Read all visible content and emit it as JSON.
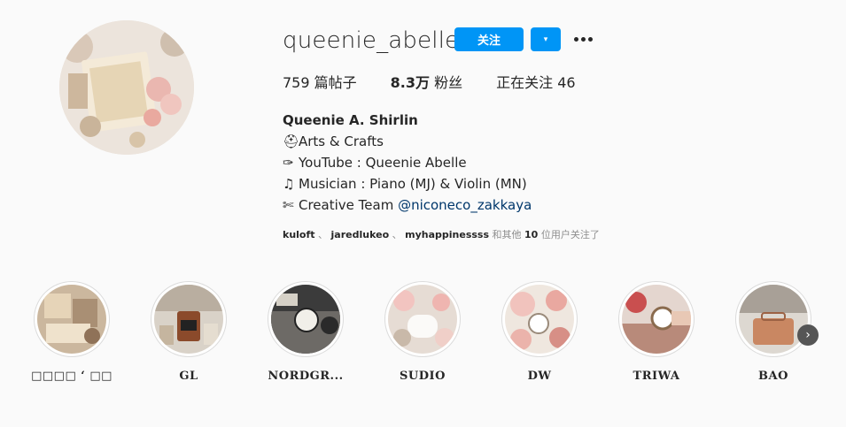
{
  "profile": {
    "username": "queenie_abelle",
    "follow_label": "关注",
    "dropdown_icon": "▾",
    "more_icon": "more-options-icon"
  },
  "stats": {
    "posts_value": "759",
    "posts_label": "篇帖子",
    "followers_value": "8.3万",
    "followers_label": "粉丝",
    "following_label": "正在关注",
    "following_value": "46"
  },
  "bio": {
    "name": "Queenie A. Shirlin",
    "lines": [
      {
        "icon": "⛑",
        "text": "Arts & Crafts"
      },
      {
        "icon": "✑",
        "text": "YouTube : Queenie Abelle"
      },
      {
        "icon": "♫",
        "text": "Musician : Piano (MJ) & Violin (MN)"
      },
      {
        "icon": "✄",
        "text": "Creative Team ",
        "mention": "@niconeco_zakkaya"
      }
    ]
  },
  "followed_by": {
    "users": [
      "kuloft",
      "jaredlukeo",
      "myhappinessss"
    ],
    "separator": " 、 ",
    "suffix_pre": " 和其他 ",
    "count": "10",
    "suffix_post": " 位用户关注了"
  },
  "highlights": [
    {
      "label": "□□□□ ‘ □□"
    },
    {
      "label": "GL"
    },
    {
      "label": "NORDGR..."
    },
    {
      "label": "SUDIO"
    },
    {
      "label": "DW"
    },
    {
      "label": "TRIWA"
    },
    {
      "label": "BAO"
    }
  ],
  "colors": {
    "accent": "#0095f6",
    "background": "#fafafa",
    "text": "#262626",
    "muted": "#8e8e8e",
    "link": "#00376b"
  }
}
